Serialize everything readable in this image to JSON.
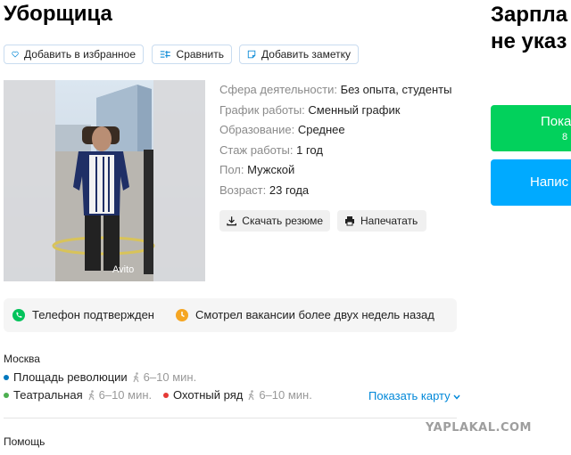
{
  "vacancy_title": "Уборщица",
  "salary": {
    "line1": "Зарпла",
    "line2": "не указ"
  },
  "actions": {
    "favorite_label": "Добавить в избранное",
    "compare_label": "Сравнить",
    "note_label": "Добавить заметку"
  },
  "photo": {
    "watermark": "Avito"
  },
  "details": [
    {
      "key": "Сфера деятельности:",
      "value": "Без опыта, студенты"
    },
    {
      "key": "График работы:",
      "value": "Сменный график"
    },
    {
      "key": "Образование:",
      "value": "Среднее"
    },
    {
      "key": "Стаж работы:",
      "value": "1 год"
    },
    {
      "key": "Пол:",
      "value": "Мужской"
    },
    {
      "key": "Возраст:",
      "value": "23 года"
    }
  ],
  "resume_actions": {
    "download_label": "Скачать резюме",
    "print_label": "Напечатать"
  },
  "contact_buttons": {
    "show_label": "Пока",
    "show_sub": "8",
    "write_label": "Напис"
  },
  "status": {
    "phone_verified": "Телефон подтвержден",
    "last_seen": "Смотрел вакансии более двух недель назад"
  },
  "location": {
    "city": "Москва",
    "metro": [
      {
        "name": "Площадь революции",
        "time": "6–10 мин.",
        "color": "#0078be"
      },
      {
        "name": "Театральная",
        "time": "6–10 мин.",
        "color": "#4caf50"
      },
      {
        "name": "Охотный ряд",
        "time": "6–10 мин.",
        "color": "#e53935"
      }
    ],
    "show_map": "Показать карту"
  },
  "footer": {
    "help": "Помощь",
    "site_watermark": "YAPLAKAL.COM"
  }
}
